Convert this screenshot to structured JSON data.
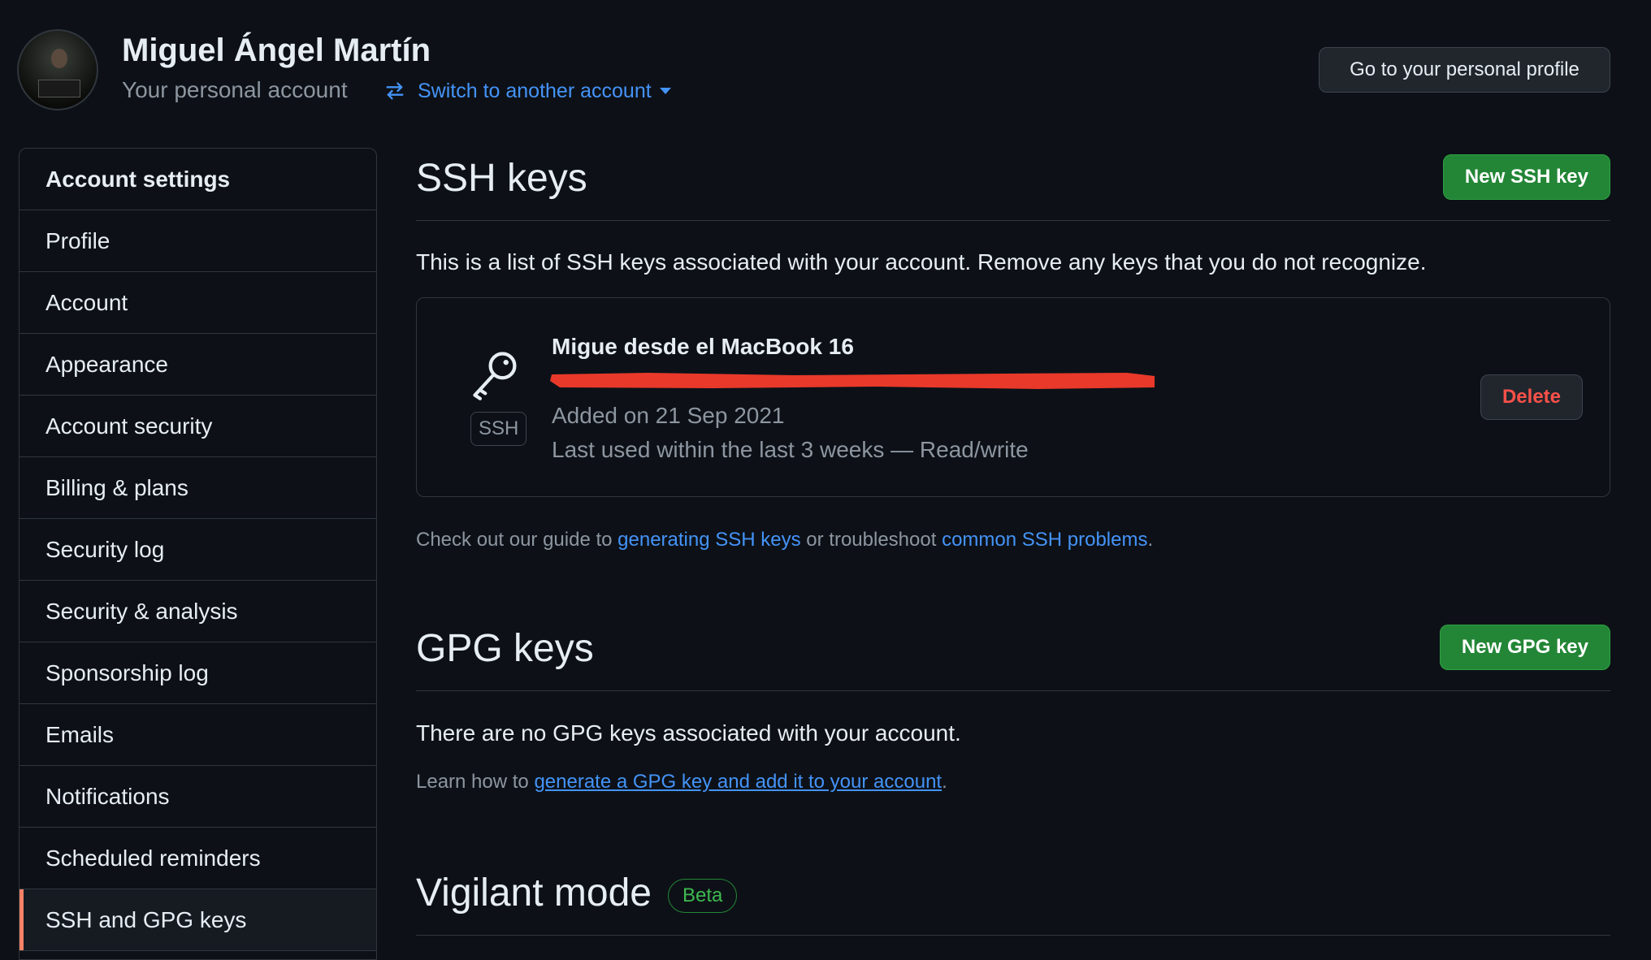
{
  "header": {
    "user_name": "Miguel Ángel Martín",
    "subtitle": "Your personal account",
    "switch_account_label": "Switch to another account",
    "profile_button_label": "Go to your personal profile"
  },
  "sidebar": {
    "header": "Account settings",
    "items": [
      {
        "label": "Profile"
      },
      {
        "label": "Account"
      },
      {
        "label": "Appearance"
      },
      {
        "label": "Account security"
      },
      {
        "label": "Billing & plans"
      },
      {
        "label": "Security log"
      },
      {
        "label": "Security & analysis"
      },
      {
        "label": "Sponsorship log"
      },
      {
        "label": "Emails"
      },
      {
        "label": "Notifications"
      },
      {
        "label": "Scheduled reminders"
      },
      {
        "label": "SSH and GPG keys"
      }
    ],
    "selected_item": "SSH and GPG keys"
  },
  "ssh": {
    "title": "SSH keys",
    "new_button_label": "New SSH key",
    "intro": "This is a list of SSH keys associated with your account. Remove any keys that you do not recognize.",
    "keys": [
      {
        "title": "Migue desde el MacBook 16",
        "badge": "SSH",
        "added": "Added on 21 Sep 2021",
        "last_used": "Last used within the last 3 weeks — Read/write",
        "delete_label": "Delete"
      }
    ],
    "guide": {
      "prefix": "Check out our guide to ",
      "link1": "generating SSH keys",
      "middle": " or troubleshoot ",
      "link2": "common SSH problems",
      "suffix": "."
    }
  },
  "gpg": {
    "title": "GPG keys",
    "new_button_label": "New GPG key",
    "empty_text": "There are no GPG keys associated with your account.",
    "learn": {
      "prefix": "Learn how to ",
      "link": "generate a GPG key and add it to your account",
      "suffix": "."
    }
  },
  "vigilant": {
    "title": "Vigilant mode",
    "badge": "Beta"
  },
  "colors": {
    "background": "#0d1117",
    "accent_link": "#4493f8",
    "primary_button": "#238636",
    "danger": "#f85149",
    "selected_indicator": "#f78166",
    "redaction": "#e8392a"
  }
}
